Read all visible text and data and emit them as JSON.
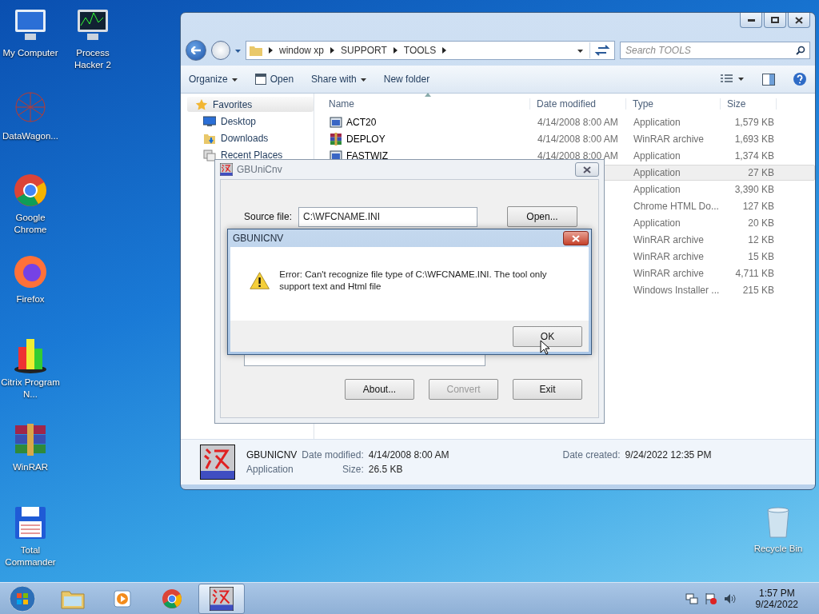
{
  "desktop_icons": [
    {
      "label": "My Computer",
      "kind": "computer"
    },
    {
      "label": "Process Hacker 2",
      "kind": "monitor"
    },
    {
      "label": "DataWagon...",
      "kind": "network"
    },
    {
      "label": "Google Chrome",
      "kind": "chrome"
    },
    {
      "label": "Firefox",
      "kind": "firefox"
    },
    {
      "label": "Citrix Program N...",
      "kind": "buildings"
    },
    {
      "label": "WinRAR",
      "kind": "books"
    },
    {
      "label": "Total Commander",
      "kind": "floppy"
    },
    {
      "label": "Recycle Bin",
      "kind": "bin"
    }
  ],
  "explorer": {
    "breadcrumb": [
      "window xp",
      "SUPPORT",
      "TOOLS"
    ],
    "search": {
      "placeholder": "Search TOOLS"
    },
    "toolbar": [
      {
        "label": "Organize",
        "kind": "menu"
      },
      {
        "label": "Open",
        "kind": "open"
      },
      {
        "label": "Share with",
        "kind": "menu"
      },
      {
        "label": "New folder",
        "kind": "plain"
      }
    ],
    "nav_header": {
      "label": "Favorites"
    },
    "nav": [
      {
        "label": "Desktop",
        "kind": "desktop"
      },
      {
        "label": "Downloads",
        "kind": "downloads"
      },
      {
        "label": "Recent Places",
        "kind": "recent"
      }
    ],
    "columns": [
      "Name",
      "Date modified",
      "Type",
      "Size"
    ],
    "rows": [
      {
        "name": "ACT20",
        "date": "4/14/2008 8:00 AM",
        "type": "Application",
        "size": "1,579 KB",
        "kind": "app",
        "selected": false
      },
      {
        "name": "DEPLOY",
        "date": "4/14/2008 8:00 AM",
        "type": "WinRAR archive",
        "size": "1,693 KB",
        "kind": "rar",
        "selected": false
      },
      {
        "name": "FASTWIZ",
        "date": "4/14/2008 8:00 AM",
        "type": "Application",
        "size": "1,374 KB",
        "kind": "app",
        "selected": false
      },
      {
        "type": "Application",
        "size": "27 KB",
        "selected": true
      },
      {
        "type": "Application",
        "size": "3,390 KB",
        "selected": false
      },
      {
        "type": "Chrome HTML Do...",
        "size": "127 KB",
        "selected": false
      },
      {
        "type": "Application",
        "size": "20 KB",
        "selected": false
      },
      {
        "type": "WinRAR archive",
        "size": "12 KB",
        "selected": false
      },
      {
        "type": "WinRAR archive",
        "size": "15 KB",
        "selected": false
      },
      {
        "type": "WinRAR archive",
        "size": "4,711 KB",
        "selected": false
      },
      {
        "type": "Windows Installer ...",
        "size": "215 KB",
        "selected": false
      }
    ],
    "details": {
      "name": "GBUNICNV",
      "kind": "Application",
      "fields": [
        {
          "label": "Date modified:",
          "value": "4/14/2008 8:00 AM"
        },
        {
          "label": "Size:",
          "value": "26.5 KB"
        },
        {
          "label": "Date created:",
          "value": "9/24/2022 12:35 PM"
        }
      ]
    }
  },
  "converter": {
    "title": "GBUniCnv",
    "source_label": "Source file:",
    "source_value": "C:\\WFCNAME.INI",
    "open_button": "Open...",
    "buttons": [
      {
        "label": "About...",
        "disabled": false
      },
      {
        "label": "Convert",
        "disabled": true
      },
      {
        "label": "Exit",
        "disabled": false
      }
    ]
  },
  "error_dialog": {
    "title": "GBUNICNV",
    "message": "Error: Can't recognize file type of C:\\WFCNAME.INI. The tool only support text and Html file",
    "ok_button": "OK"
  },
  "taskbar": {
    "apps": [
      {
        "kind": "folder",
        "selected": false
      },
      {
        "kind": "media",
        "selected": false
      },
      {
        "kind": "chrome",
        "selected": false
      },
      {
        "kind": "gb2u",
        "selected": true
      }
    ],
    "time": "1:57 PM",
    "date": "9/24/2022"
  }
}
